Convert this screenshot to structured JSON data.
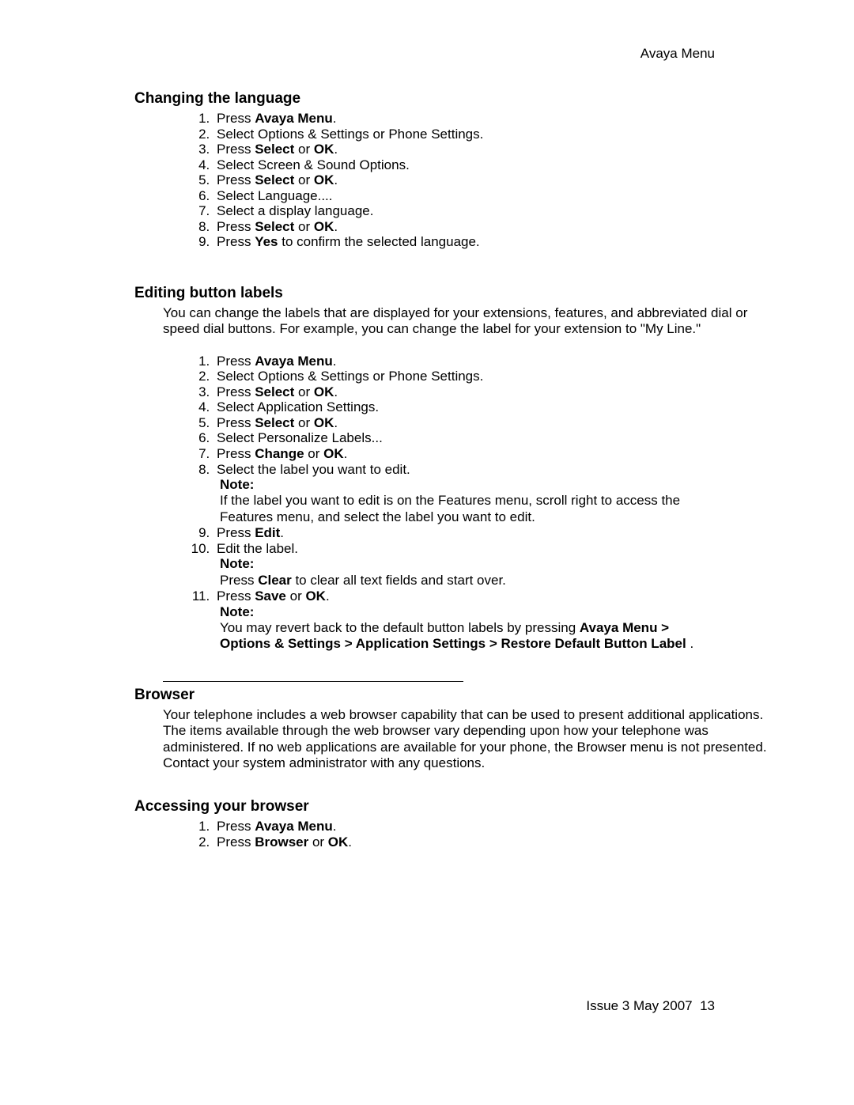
{
  "header": {
    "right_text": "Avaya Menu"
  },
  "sections": {
    "changing_language": {
      "title": "Changing the language",
      "steps": [
        {
          "pre": "Press ",
          "bold": "Avaya Menu",
          "post": "."
        },
        {
          "pre": "Select Options & Settings or Phone Settings."
        },
        {
          "pre": "Press ",
          "bold": "Select",
          "mid": " or ",
          "bold2": "OK",
          "post": "."
        },
        {
          "pre": "Select Screen & Sound Options."
        },
        {
          "pre": "Press ",
          "bold": "Select",
          "mid": " or ",
          "bold2": "OK",
          "post": "."
        },
        {
          "pre": "Select Language...."
        },
        {
          "pre": "Select a display language."
        },
        {
          "pre": "Press ",
          "bold": "Select",
          "mid": " or ",
          "bold2": "OK",
          "post": "."
        },
        {
          "pre": "Press ",
          "bold": "Yes",
          "post": " to confirm the selected language."
        }
      ]
    },
    "editing_labels": {
      "title": "Editing button labels",
      "intro": "You can change the labels that are displayed for your extensions, features, and abbreviated dial or speed dial buttons. For example, you can change the label for your extension to \"My Line.\"",
      "steps_a": [
        {
          "pre": "Press ",
          "bold": "Avaya Menu",
          "post": "."
        },
        {
          "pre": "Select Options & Settings or Phone Settings."
        },
        {
          "pre": "Press ",
          "bold": "Select",
          "mid": " or ",
          "bold2": "OK",
          "post": "."
        },
        {
          "pre": "Select Application Settings."
        },
        {
          "pre": "Press ",
          "bold": "Select",
          "mid": " or ",
          "bold2": "OK",
          "post": "."
        },
        {
          "pre": "Select Personalize Labels..."
        },
        {
          "pre": "Press ",
          "bold": "Change",
          "mid": " or ",
          "bold2": "OK",
          "post": "."
        },
        {
          "pre": "Select the label you want to edit."
        }
      ],
      "note1_label": "Note:",
      "note1_body": "If the label you want to edit is on the Features menu, scroll right to access the Features menu, and select the label you want to edit.",
      "steps_b": [
        {
          "pre": "Press ",
          "bold": "Edit",
          "post": "."
        },
        {
          "pre": "Edit the label."
        }
      ],
      "note2_label": "Note:",
      "note2_body_pre": "Press ",
      "note2_body_bold": "Clear",
      "note2_body_post": " to clear all text fields and start over.",
      "steps_c": [
        {
          "pre": "Press ",
          "bold": "Save",
          "mid": " or ",
          "bold2": "OK",
          "post": "."
        }
      ],
      "note3_label": "Note:",
      "note3_body_pre": "You may revert back to the default button labels by pressing  ",
      "note3_path1": "Avaya Menu",
      "note3_sep": " > ",
      "note3_path2": "Options & Settings",
      "note3_path3": "Application Settings",
      "note3_path4": "Restore Default Button Label",
      "note3_post": " ."
    },
    "browser": {
      "title": "Browser",
      "intro": "Your telephone includes a web browser capability that can be used to present additional applications. The items available through the web browser vary depending upon how your telephone was administered. If no web applications are available for your phone, the Browser menu is not presented. Contact your system administrator with any questions."
    },
    "accessing_browser": {
      "title": "Accessing your browser",
      "steps": [
        {
          "pre": "Press ",
          "bold": "Avaya Menu",
          "post": "."
        },
        {
          "pre": "Press ",
          "bold": "Browser",
          "mid": " or ",
          "bold2": "OK",
          "post": "."
        }
      ]
    }
  },
  "footer": {
    "left": "Issue 3 May 2007",
    "page_num": "13"
  }
}
